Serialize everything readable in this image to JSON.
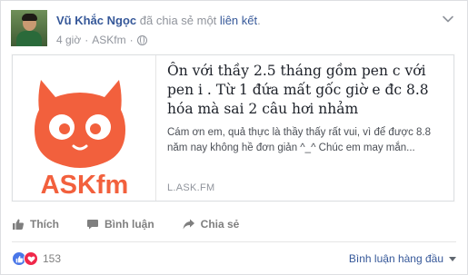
{
  "post": {
    "author_name": "Vũ Khắc Ngọc",
    "action_text": "đã chia sẻ một",
    "link_word": "liên kết",
    "trailing_dot": ".",
    "time": "4 giờ",
    "separator": "·",
    "source": "ASKfm",
    "privacy_icon": "globe-icon",
    "options_icon": "chevron-down-icon"
  },
  "link_preview": {
    "title": "Ôn với thầy 2.5 tháng gồm pen c với pen i . Từ 1 đứa mất gốc giờ e đc 8.8 hóa mà sai 2 câu hơi nhảm",
    "description": "Cám ơn em, quả thực là thầy thấy rất vui, vì để được 8.8 năm nay không hề đơn giản ^_^ Chúc em may mắn...",
    "domain": "L.ASK.FM",
    "thumbnail_icon": "askfm-logo",
    "thumbnail_text": "ASKfm",
    "brand_color": "#f2603d"
  },
  "actions": {
    "like_label": "Thích",
    "comment_label": "Bình luận",
    "share_label": "Chia sẻ"
  },
  "reactions": {
    "count": "153",
    "types": [
      "like",
      "love"
    ],
    "like_color": "#4a77e8",
    "love_color": "#f0284a"
  },
  "comments": {
    "sort_label": "Bình luận hàng đầu"
  }
}
